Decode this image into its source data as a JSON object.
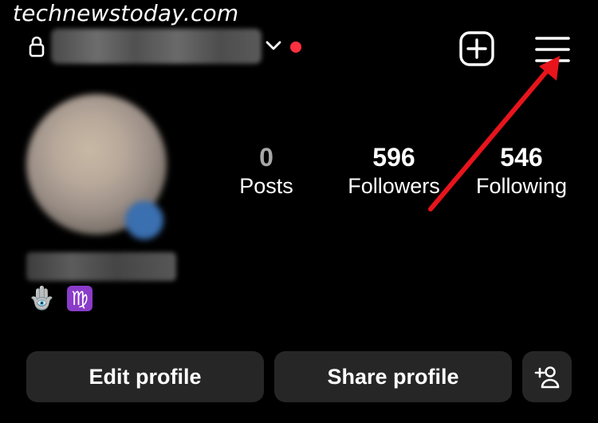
{
  "watermark": "technewstoday.com",
  "header": {
    "username_hidden": true
  },
  "stats": [
    {
      "value": "0",
      "label": "Posts"
    },
    {
      "value": "596",
      "label": "Followers"
    },
    {
      "value": "546",
      "label": "Following"
    }
  ],
  "bio": {
    "emoji_1": "🪬",
    "emoji_2": "♍"
  },
  "actions": {
    "edit_label": "Edit profile",
    "share_label": "Share profile"
  },
  "colors": {
    "background": "#000000",
    "button_bg": "#262626",
    "notification_dot": "#ff3040",
    "annotation_arrow": "#e8141c"
  }
}
